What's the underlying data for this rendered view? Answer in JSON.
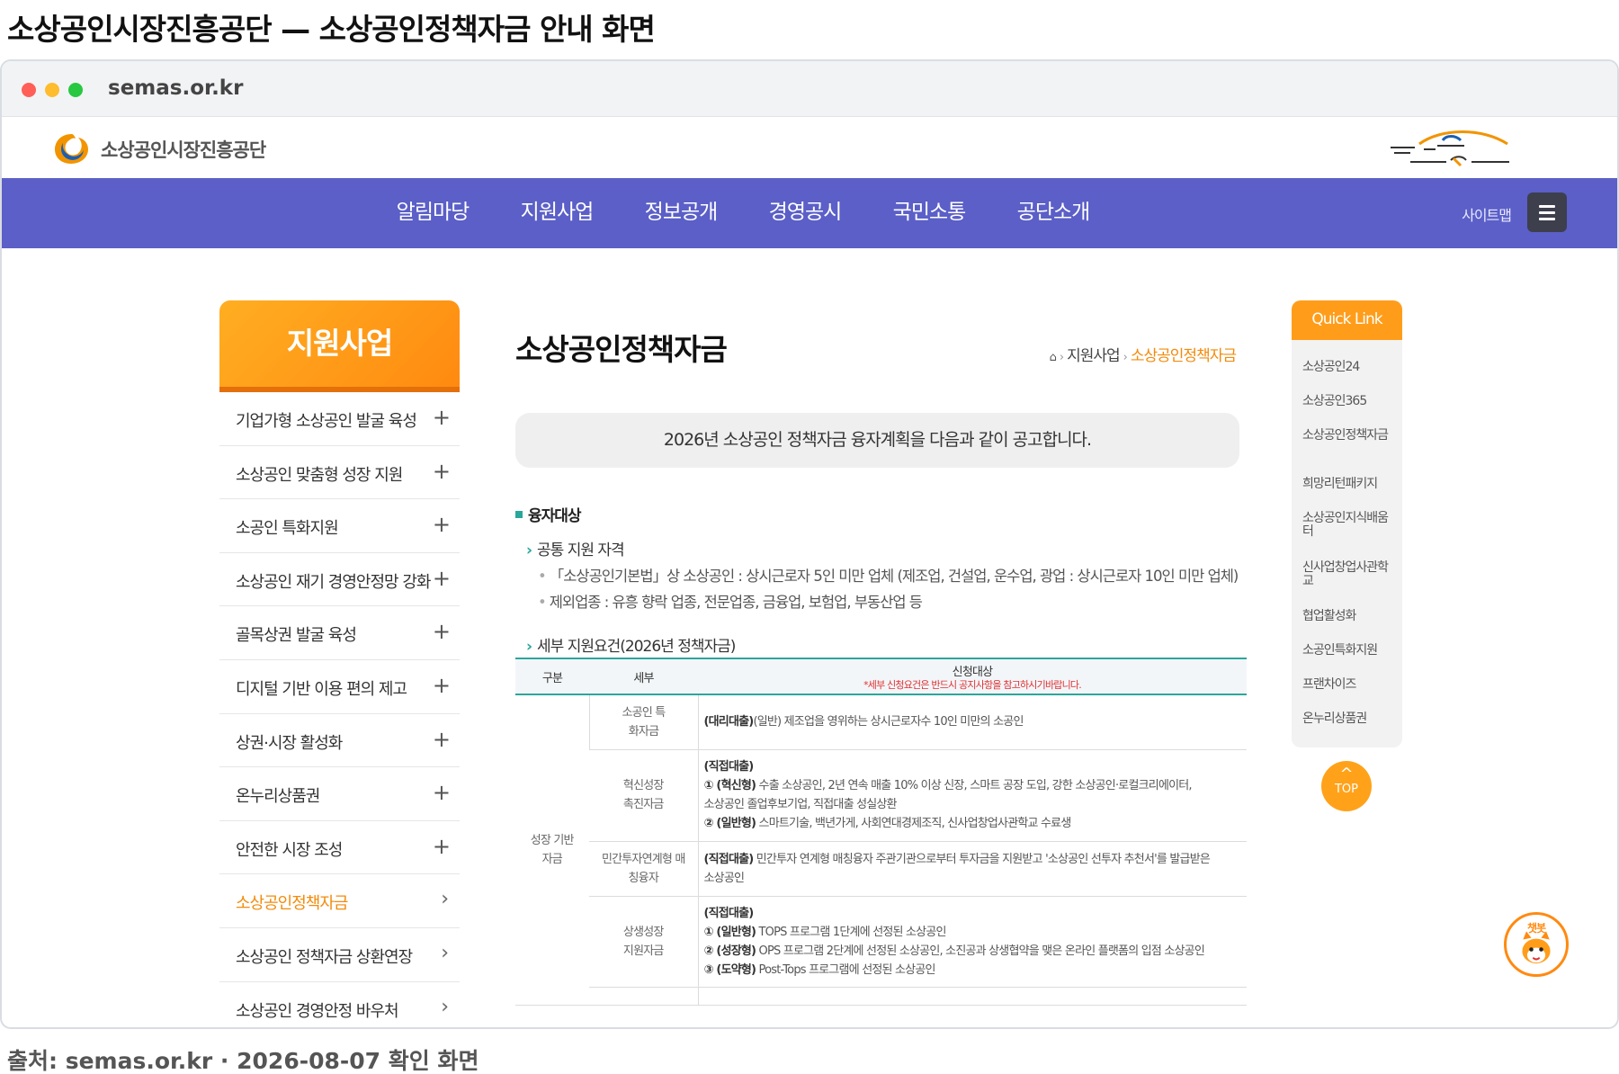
{
  "caption": {
    "title": "소상공인시장진흥공단 — 소상공인정책자금 안내 화면",
    "source": "출처: semas.or.kr · 2026-08-07 확인 화면"
  },
  "browser": {
    "url": "semas.or.kr"
  },
  "header": {
    "logo_text": "소상공인시장진흥공단",
    "slogan_icon": "slogan-calligraphy"
  },
  "gnb": {
    "items": [
      "알림마당",
      "지원사업",
      "정보공개",
      "경영공시",
      "국민소통",
      "공단소개"
    ],
    "sitemap_label": "사이트맵",
    "menu_icon": "hamburger-icon"
  },
  "lnb": {
    "title": "지원사업",
    "items": [
      {
        "label": "기업가형 소상공인 발굴 육성",
        "mark": "+"
      },
      {
        "label": "소상공인 맞춤형 성장 지원",
        "mark": "+"
      },
      {
        "label": "소공인 특화지원",
        "mark": "+"
      },
      {
        "label": "소상공인 재기 경영안정망 강화",
        "mark": "+"
      },
      {
        "label": "골목상권 발굴 육성",
        "mark": "+"
      },
      {
        "label": "디지털 기반 이용 편의 제고",
        "mark": "+"
      },
      {
        "label": "상권·시장 활성화",
        "mark": "+"
      },
      {
        "label": "온누리상품권",
        "mark": "+"
      },
      {
        "label": "안전한 시장 조성",
        "mark": "+"
      },
      {
        "label": "소상공인정책자금",
        "mark": "›"
      },
      {
        "label": "소상공인 정책자금 상환연장",
        "mark": "›"
      },
      {
        "label": "소상공인 경영안정 바우처",
        "mark": "›"
      }
    ],
    "active_index": 9
  },
  "main": {
    "title": "소상공인정책자금",
    "breadcrumb": [
      "지원사업",
      "소상공인정책자금"
    ],
    "notice": "2026년 소상공인 정책자금 융자계획을 다음과 같이 공고합니다.",
    "section_title": "융자대상",
    "subsection1": "공통 지원 자격",
    "bullets": [
      "「소상공인기본법」상 소상공인 : 상시근로자 5인 미만 업체 (제조업, 건설업, 운수업, 광업 : 상시근로자 10인 미만 업체)",
      "제외업종 : 유흥 향락 업종, 전문업종, 금융업, 보험업, 부동산업 등"
    ],
    "subsection2": "세부 지원요건(2026년 정책자금)",
    "table": {
      "headers": [
        "구분",
        "세부",
        "신청대상"
      ],
      "warning": "*세부 신청요건은 반드시 공지사항을 참고하시기바랍니다.",
      "category": "성장 기반자금",
      "rows": [
        {
          "sub": "소공인 특화자금",
          "lines": [
            {
              "tag": "(대리대출)",
              "text": "(일반) 제조업을 영위하는 상시근로자수 10인 미만의 소공인"
            }
          ]
        },
        {
          "sub": "혁신성장 촉진자금",
          "lines": [
            {
              "tag": "(직접대출)",
              "text": ""
            },
            {
              "tag": "① (혁신형)",
              "text": " 수출 소상공인, 2년 연속 매출 10% 이상 신장, 스마트 공장 도입, 강한 소상공인·로컬크리에이터,"
            },
            {
              "tag": "",
              "text": "소상공인 졸업후보기업, 직접대출 성실상환"
            },
            {
              "tag": "② (일반형)",
              "text": " 스마트기술, 백년가게, 사회연대경제조직, 신사업창업사관학교 수료생"
            }
          ]
        },
        {
          "sub": "민간투자연계형 매칭융자",
          "lines": [
            {
              "tag": "(직접대출)",
              "text": " 민간투자 연계형 매칭융자 주관기관으로부터 투자금을 지원받고 '소상공인 선투자 추천서'를 발급받은"
            },
            {
              "tag": "",
              "text": "소상공인"
            }
          ]
        },
        {
          "sub": "상생성장 지원자금",
          "lines": [
            {
              "tag": "(직접대출)",
              "text": ""
            },
            {
              "tag": "① (일반형)",
              "text": " TOPS 프로그램 1단계에 선정된 소상공인"
            },
            {
              "tag": "② (성장형)",
              "text": " OPS 프로그램 2단계에 선정된 소상공인, 소진공과 상생협약을 맺은 온라인 플랫폼의 입점 소상공인"
            },
            {
              "tag": "③ (도약형)",
              "text": " Post-Tops 프로그램에 선정된 소상공인"
            }
          ]
        }
      ]
    }
  },
  "quick_link": {
    "title": "Quick Link",
    "items": [
      "소상공인24",
      "소상공인365",
      "소상공인정책자금",
      "희망리턴패키지",
      "소상공인지식배움터",
      "신사업창업사관학교",
      "협업활성화",
      "소공인특화지원",
      "프랜차이즈",
      "온누리상품권"
    ]
  },
  "top_button": {
    "arrow": "^",
    "label": "TOP"
  },
  "chatbot": {
    "label": "챗봇",
    "icon": "chatbot-mascot-icon"
  },
  "colors": {
    "gnb": "#5b5fc7",
    "accent_orange": "#ff8a10",
    "teal": "#2aa79b",
    "warning_red": "#e03131"
  }
}
